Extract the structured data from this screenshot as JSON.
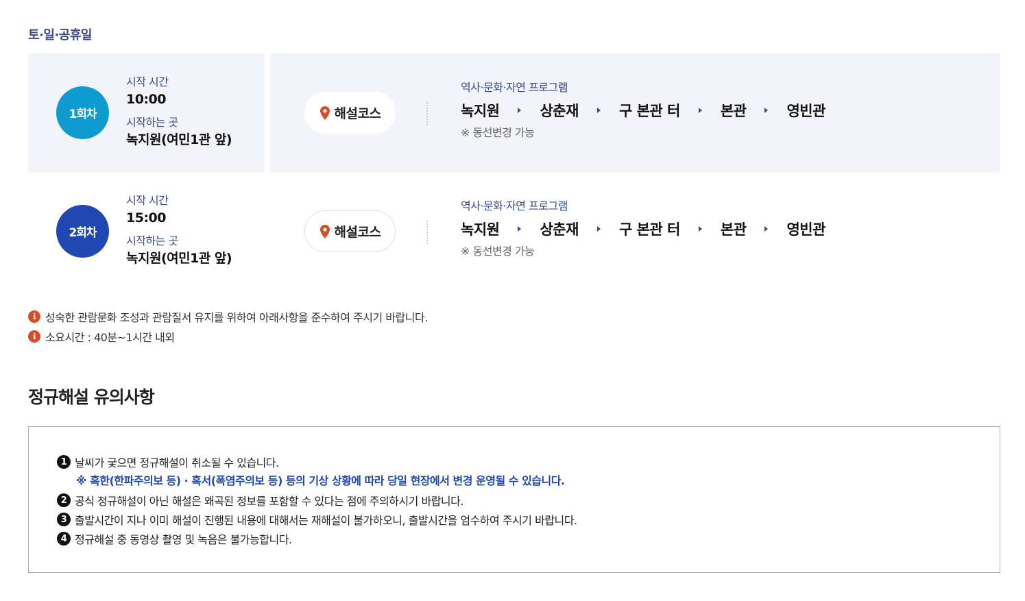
{
  "section_label": "토·일·공휴일",
  "sessions": [
    {
      "badge": "1회차",
      "start_time_label": "시작 시간",
      "start_time": "10:00",
      "start_place_label": "시작하는 곳",
      "start_place": "녹지원(여민1관 앞)",
      "course_label": "해설코스",
      "program_title": "역사·문화·자연 프로그램",
      "stops": [
        "녹지원",
        "상춘재",
        "구 본관 터",
        "본관",
        "영빈관"
      ],
      "note": "※ 동선변경 가능"
    },
    {
      "badge": "2회차",
      "start_time_label": "시작 시간",
      "start_time": "15:00",
      "start_place_label": "시작하는 곳",
      "start_place": "녹지원(여민1관 앞)",
      "course_label": "해설코스",
      "program_title": "역사·문화·자연 프로그램",
      "stops": [
        "녹지원",
        "상춘재",
        "구 본관 터",
        "본관",
        "영빈관"
      ],
      "note": "※ 동선변경 가능"
    }
  ],
  "notices": [
    "성숙한 관람문화 조성과 관람질서 유지를 위하여 아래사항을 준수하여 주시기 바랍니다.",
    "소요시간 : 40분~1시간 내외"
  ],
  "caution_heading": "정규해설 유의사항",
  "cautions": [
    {
      "num": "1",
      "text": "날씨가 궂으면 정규해설이 취소될 수 있습니다.",
      "sub": "※ 혹한(한파주의보 등) · 혹서(폭염주의보 등) 등의 기상 상황에 따라 당일 현장에서 변경 운영될 수 있습니다."
    },
    {
      "num": "2",
      "text": "공식 정규해설이 아닌 해설은 왜곡된 정보를 포함할 수 있다는 점에 주의하시기 바랍니다."
    },
    {
      "num": "3",
      "text": "출발시간이 지나 이미 해설이 진행된 내용에 대해서는 재해설이 불가하오니, 출발시간을 엄수하여 주시기 바랍니다."
    },
    {
      "num": "4",
      "text": "정규해설 중 동영상 촬영 및 녹음은 불가능합니다."
    }
  ],
  "colors": {
    "badge_1": "#0e9bd0",
    "badge_2": "#2148b2",
    "label_navy": "#3a4a86",
    "info_icon": "#d94c2a",
    "sub_note_blue": "#2148b2",
    "panel_bg": "#f2f4f9"
  },
  "icons": {
    "pin": "map-pin-icon",
    "info": "info-circle-icon",
    "arrow": "triangle-right-icon"
  }
}
